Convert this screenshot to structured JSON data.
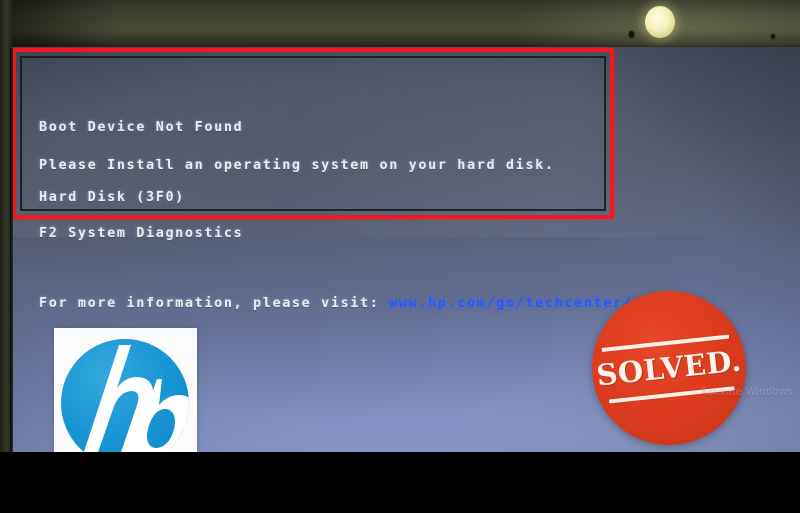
{
  "scene": {
    "description": "Photograph of a laptop screen showing an HP BIOS boot error, annotated with a red rectangle and a SOLVED badge"
  },
  "bios": {
    "title": "Boot Device Not Found",
    "instruction": "Please Install an operating system on your hard disk.",
    "hard_disk": "Hard Disk (3F0)",
    "f2_key": "F2    System Diagnostics",
    "info_prefix": "For more information, please visit: ",
    "info_url": "www.hp.com/go/techcenter/startup"
  },
  "annotation": {
    "red_box_color": "#f11822",
    "red_box_label": "highlighted-error-region"
  },
  "hp_logo": {
    "wordmark": "hp",
    "brand_color": "#1896d4",
    "background_color": "#fbfbfc"
  },
  "solved_badge": {
    "label": "SOLVED.",
    "badge_color": "#dd3c1f",
    "text_color": "#f9f3ea"
  },
  "watermark": {
    "text": "Activate Windows"
  },
  "hardware": {
    "webcam_label": "webcam-indicator",
    "bezel_color": "#3e4231"
  }
}
